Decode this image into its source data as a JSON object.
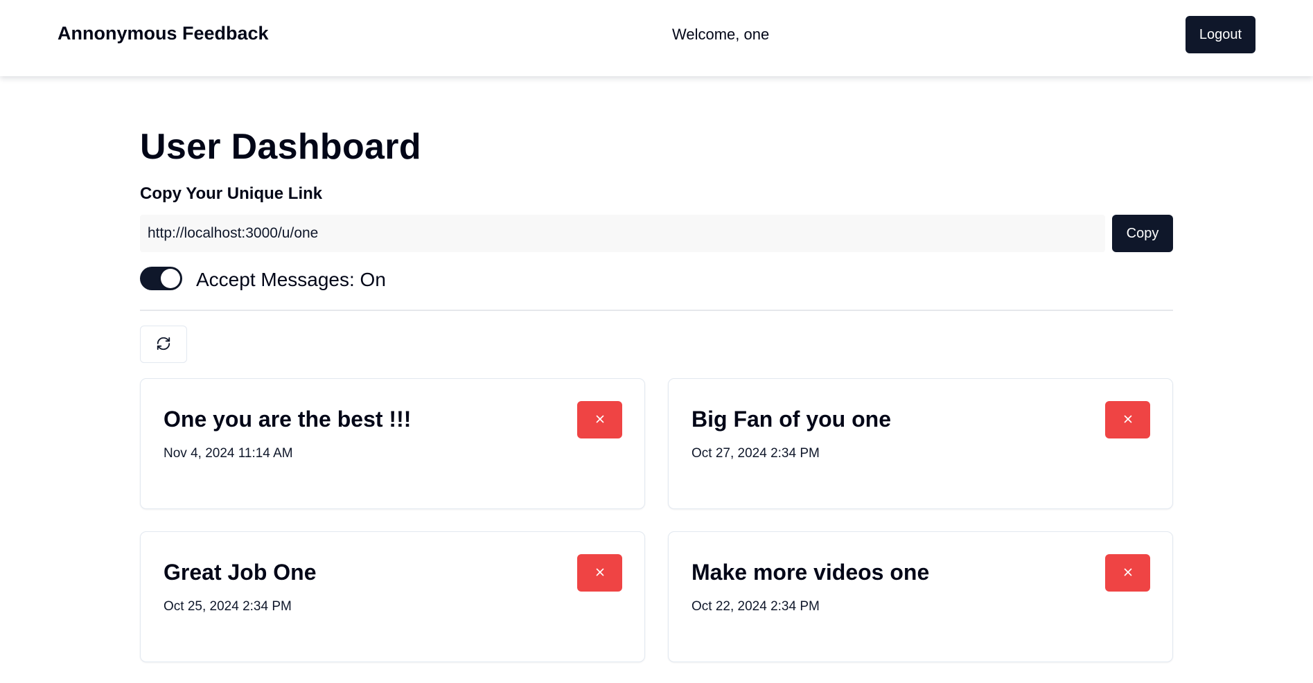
{
  "header": {
    "brand": "Annonymous Feedback",
    "welcome": "Welcome, one",
    "logout_label": "Logout"
  },
  "dashboard": {
    "title": "User Dashboard",
    "link_heading": "Copy Your Unique Link",
    "unique_link": "http://localhost:3000/u/one",
    "copy_label": "Copy",
    "accept_messages": true,
    "accept_messages_label": "Accept Messages: On",
    "refresh_icon": "refresh-icon"
  },
  "messages": [
    {
      "content": "One you are the best !!!",
      "date": "Nov 4, 2024 11:14 AM"
    },
    {
      "content": "Big Fan of you one",
      "date": "Oct 27, 2024 2:34 PM"
    },
    {
      "content": "Great Job One",
      "date": "Oct 25, 2024 2:34 PM"
    },
    {
      "content": "Make more videos one",
      "date": "Oct 22, 2024 2:34 PM"
    }
  ],
  "colors": {
    "primary": "#0f172a",
    "danger": "#ef4444",
    "border": "#e2e8f0",
    "input_bg": "#f8f8f8"
  }
}
